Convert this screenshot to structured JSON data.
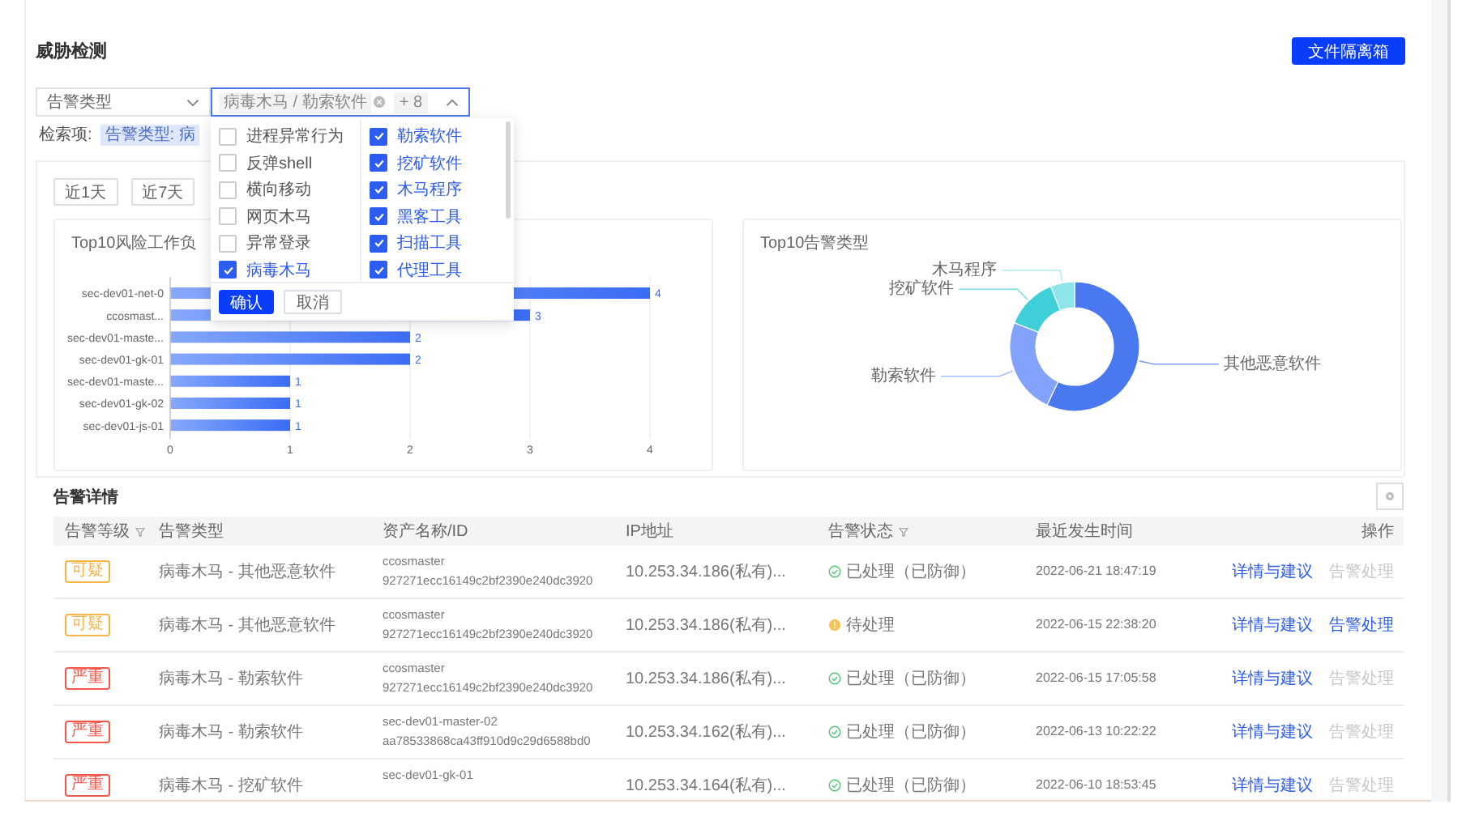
{
  "page": {
    "title": "威胁检测",
    "isolation_button": "文件隔离箱"
  },
  "filters": {
    "type_select": {
      "value": "告警类型"
    },
    "multi_select": {
      "tags": [
        "病毒木马 / 勒索软件"
      ],
      "more": "+ 8",
      "expanded": true
    },
    "dropdown": {
      "columns": [
        [
          {
            "label": "进程异常行为",
            "checked": false
          },
          {
            "label": "反弹shell",
            "checked": false
          },
          {
            "label": "横向移动",
            "checked": false
          },
          {
            "label": "网页木马",
            "checked": false
          },
          {
            "label": "异常登录",
            "checked": false
          },
          {
            "label": "病毒木马",
            "checked": true
          }
        ],
        [
          {
            "label": "勒索软件",
            "checked": true
          },
          {
            "label": "挖矿软件",
            "checked": true
          },
          {
            "label": "木马程序",
            "checked": true
          },
          {
            "label": "黑客工具",
            "checked": true
          },
          {
            "label": "扫描工具",
            "checked": true
          },
          {
            "label": "代理工具",
            "checked": true
          }
        ]
      ],
      "confirm": "确认",
      "cancel": "取消"
    }
  },
  "search_items": {
    "label": "检索项:",
    "chips": [
      "告警类型: 病"
    ]
  },
  "time_range": [
    "近1天",
    "近7天"
  ],
  "bar_card": {
    "chart_data": {
      "type": "bar",
      "orientation": "horizontal",
      "title": "Top10风险工作负",
      "categories": [
        "sec-dev01-net-0",
        "ccosmast...",
        "sec-dev01-maste...",
        "sec-dev01-gk-01",
        "sec-dev01-maste...",
        "sec-dev01-gk-02",
        "sec-dev01-js-01"
      ],
      "values": [
        4,
        3,
        2,
        2,
        1,
        1,
        1
      ],
      "xlim": [
        0,
        4
      ],
      "xticks": [
        0,
        1,
        2,
        3,
        4
      ],
      "grid": true,
      "data_labels": true
    }
  },
  "donut_card": {
    "chart_data": {
      "type": "donut",
      "title": "Top10告警类型",
      "categories": [
        "其他恶意软件",
        "勒索软件",
        "挖矿软件",
        "木马程序"
      ],
      "values": [
        0.57,
        0.24,
        0.13,
        0.06
      ],
      "colors": [
        "#4a78ee",
        "#82a2fb",
        "#3ecfd8",
        "#8fe5ea"
      ]
    }
  },
  "alert_details": {
    "title": "告警详情",
    "columns": [
      {
        "label": "告警等级",
        "filterable": true
      },
      {
        "label": "告警类型",
        "filterable": false
      },
      {
        "label": "资产名称/ID",
        "filterable": false
      },
      {
        "label": "IP地址",
        "filterable": false
      },
      {
        "label": "告警状态",
        "filterable": true
      },
      {
        "label": "最近发生时间",
        "filterable": false
      },
      {
        "label": "操作",
        "filterable": false
      }
    ],
    "rows": [
      {
        "level": "可疑",
        "color": "#f5b548",
        "type": "病毒木马 - 其他恶意软件",
        "asset": "ccosmaster",
        "asset_id": "927271ecc16149c2bf2390e240dc3920",
        "ip": "10.253.34.186(私有)...",
        "status": {
          "kind": "done",
          "text": "已处理（已防御）"
        },
        "time": "2022-06-21 18:47:19",
        "actions": [
          {
            "label": "详情与建议",
            "disabled": false
          },
          {
            "label": "告警处理",
            "disabled": true
          }
        ]
      },
      {
        "level": "可疑",
        "color": "#f5b548",
        "type": "病毒木马 - 其他恶意软件",
        "asset": "ccosmaster",
        "asset_id": "927271ecc16149c2bf2390e240dc3920",
        "ip": "10.253.34.186(私有)...",
        "status": {
          "kind": "pending",
          "text": "待处理"
        },
        "time": "2022-06-15 22:38:20",
        "actions": [
          {
            "label": "详情与建议",
            "disabled": false
          },
          {
            "label": "告警处理",
            "disabled": false
          }
        ]
      },
      {
        "level": "严重",
        "color": "#f5564a",
        "type": "病毒木马 - 勒索软件",
        "asset": "ccosmaster",
        "asset_id": "927271ecc16149c2bf2390e240dc3920",
        "ip": "10.253.34.186(私有)...",
        "status": {
          "kind": "done",
          "text": "已处理（已防御）"
        },
        "time": "2022-06-15 17:05:58",
        "actions": [
          {
            "label": "详情与建议",
            "disabled": false
          },
          {
            "label": "告警处理",
            "disabled": true
          }
        ]
      },
      {
        "level": "严重",
        "color": "#f5564a",
        "type": "病毒木马 - 勒索软件",
        "asset": "sec-dev01-master-02",
        "asset_id": "aa78533868ca43ff910d9c29d6588bd0",
        "ip": "10.253.34.162(私有)...",
        "status": {
          "kind": "done",
          "text": "已处理（已防御）"
        },
        "time": "2022-06-13 10:22:22",
        "actions": [
          {
            "label": "详情与建议",
            "disabled": false
          },
          {
            "label": "告警处理",
            "disabled": true
          }
        ]
      },
      {
        "level": "严重",
        "color": "#f5564a",
        "type": "病毒木马 - 挖矿软件",
        "asset": "sec-dev01-gk-01",
        "ip": "10.253.34.164(私有)...",
        "status": {
          "kind": "done",
          "text": "已处理（已防御）"
        },
        "time": "2022-06-10 18:53:45",
        "actions": [
          {
            "label": "详情与建议",
            "disabled": false
          },
          {
            "label": "告警处理",
            "disabled": true
          }
        ]
      }
    ]
  }
}
